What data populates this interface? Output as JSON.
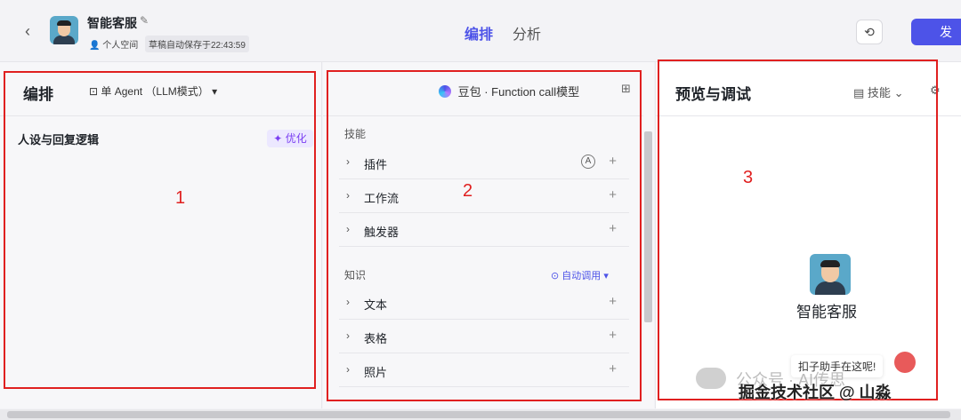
{
  "header": {
    "back_icon": "chevron-left-icon",
    "bot_title": "智能客服",
    "edit_icon": "edit-icon",
    "space_label": "个人空间",
    "autosave_text": "草稿自动保存于22:43:59",
    "tabs": [
      {
        "label": "编排",
        "active": true
      },
      {
        "label": "分析",
        "active": false
      }
    ],
    "history_icon": "history-icon",
    "publish_label": "发"
  },
  "panel_arrange": {
    "title": "编排",
    "mode_label": "单 Agent （LLM模式）",
    "persona_label": "人设与回复逻辑",
    "optimize_label": "优化"
  },
  "panel_skills": {
    "model_label": "豆包 · Function call模型",
    "skills_section": "技能",
    "skills": [
      {
        "label": "插件"
      },
      {
        "label": "工作流"
      },
      {
        "label": "触发器"
      }
    ],
    "knowledge_section": "知识",
    "auto_call_label": "自动调用",
    "knowledge": [
      {
        "label": "文本"
      },
      {
        "label": "表格"
      },
      {
        "label": "照片"
      }
    ]
  },
  "panel_preview": {
    "title": "预览与调试",
    "skill_toggle_label": "技能",
    "bot_name": "智能客服",
    "helper_text": "扣子助手在这呢!"
  },
  "annotations": [
    "1",
    "2",
    "3"
  ],
  "watermarks": {
    "line1": "公众号 · AI传思",
    "line2": "掘金技术社区 @ 山淼"
  },
  "colors": {
    "accent": "#4d53e8",
    "annotation_red": "#e02020",
    "optimize_purple": "#7b3ff2"
  }
}
